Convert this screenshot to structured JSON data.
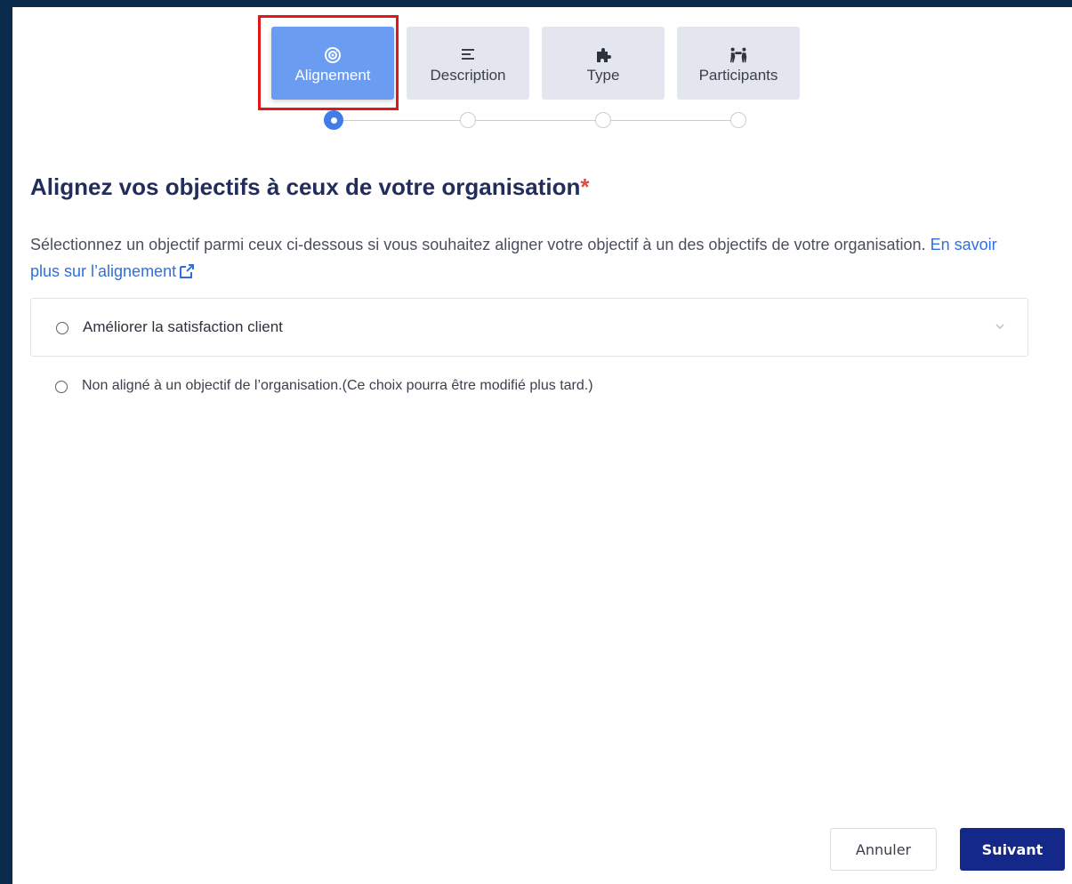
{
  "steps": [
    {
      "label": "Alignement",
      "icon": "target-icon",
      "active": true
    },
    {
      "label": "Description",
      "icon": "text-lines-icon",
      "active": false
    },
    {
      "label": "Type",
      "icon": "puzzle-icon",
      "active": false
    },
    {
      "label": "Participants",
      "icon": "people-icon",
      "active": false
    }
  ],
  "main": {
    "title": "Alignez vos objectifs à ceux de votre organisation",
    "required_mark": "*",
    "description": "Sélectionnez un objectif parmi ceux ci-dessous si vous souhaitez aligner votre objectif à un des objectifs de votre organisation. ",
    "learn_more_link": "En savoir plus sur l’alignement"
  },
  "options": {
    "objective": "Améliorer la satisfaction client",
    "not_aligned": "Non aligné à un objectif de l’organisation.(Ce choix pourra être modifié plus tard.)"
  },
  "footer": {
    "cancel_label": "Annuler",
    "next_label": "Suivant"
  },
  "colors": {
    "active_tab": "#6a9df2",
    "primary_button": "#14288a",
    "link": "#2f6fe0",
    "title": "#232d5b",
    "required": "#e24a4a",
    "highlight": "#e21616"
  }
}
